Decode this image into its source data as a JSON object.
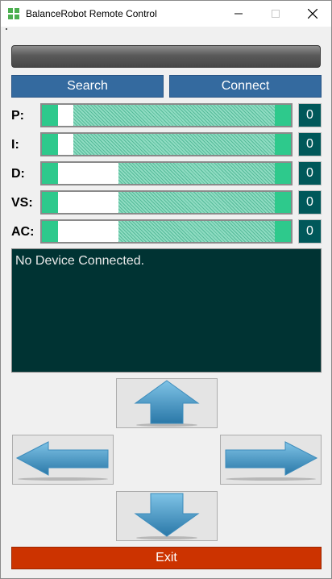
{
  "window": {
    "title": "BalanceRobot Remote Control"
  },
  "buttons": {
    "search": "Search",
    "connect": "Connect",
    "exit": "Exit"
  },
  "params": [
    {
      "label": "P:",
      "value": "0",
      "level": 0.07
    },
    {
      "label": "I:",
      "value": "0",
      "level": 0.07
    },
    {
      "label": "D:",
      "value": "0",
      "level": 0.28
    },
    {
      "label": "VS:",
      "value": "0",
      "level": 0.28
    },
    {
      "label": "AC:",
      "value": "0",
      "level": 0.28
    }
  ],
  "console": {
    "text": "No Device Connected."
  },
  "arrows": {
    "up": "arrow-up-icon",
    "left": "arrow-left-icon",
    "right": "arrow-right-icon",
    "down": "arrow-down-icon"
  },
  "colors": {
    "blue_button": "#346a9f",
    "slider_green": "#2ec98c",
    "value_box": "#00585a",
    "console_bg": "#003333",
    "exit": "#cc3300"
  }
}
